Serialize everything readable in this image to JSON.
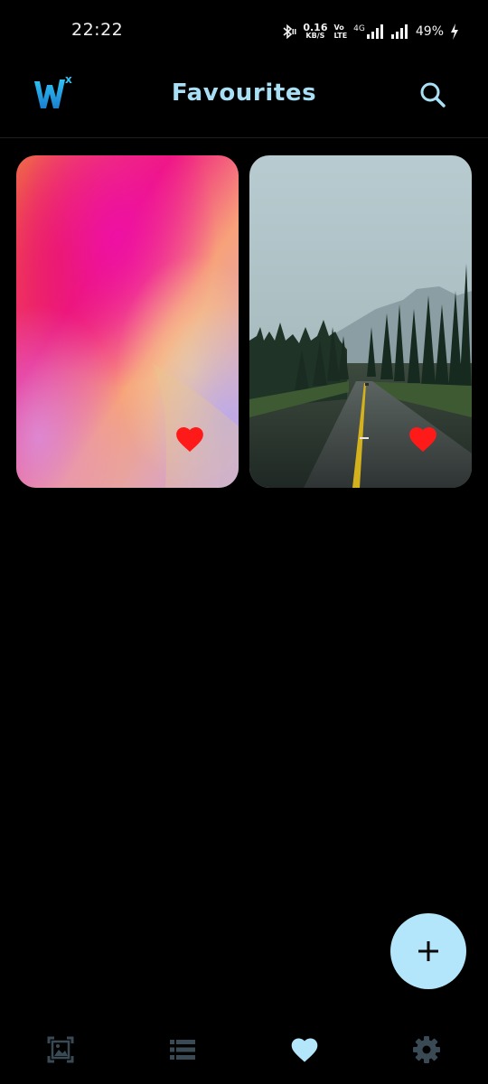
{
  "status_bar": {
    "time": "22:22",
    "net_speed_value": "0.16",
    "net_speed_unit": "KB/S",
    "volte_top": "Vo",
    "volte_bottom": "LTE",
    "network_type": "4G",
    "battery": "49%"
  },
  "app_bar": {
    "title": "Favourites",
    "logo_letter": "W",
    "logo_superscript": "x"
  },
  "favourites": [
    {
      "name": "pink-gradient-wallpaper",
      "favourited": true
    },
    {
      "name": "forest-road-wallpaper",
      "favourited": true
    }
  ],
  "icons": {
    "search": "search-icon",
    "fab": "plus-icon",
    "heart": "heart-icon",
    "nav": [
      "wallpaper-icon",
      "list-icon",
      "heart-icon",
      "gear-icon"
    ]
  },
  "colors": {
    "background": "#000000",
    "accent": "#a9dff4",
    "fab": "#b3e6fb",
    "heart": "#ff1a1a",
    "nav_inactive": "#3a4a55",
    "nav_active": "#b3e6fb"
  },
  "bottom_nav": {
    "active": "favourites",
    "items": [
      "wallpapers",
      "categories",
      "favourites",
      "settings"
    ]
  }
}
